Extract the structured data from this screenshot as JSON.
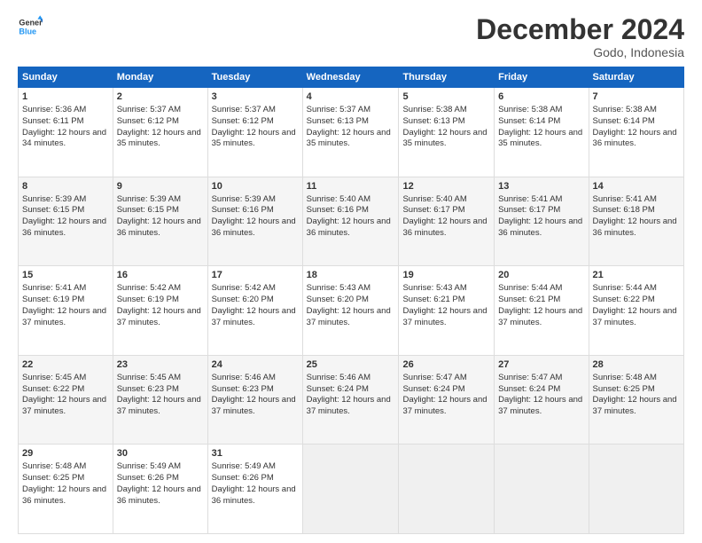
{
  "header": {
    "logo_line1": "General",
    "logo_line2": "Blue",
    "title": "December 2024",
    "subtitle": "Godo, Indonesia"
  },
  "days_of_week": [
    "Sunday",
    "Monday",
    "Tuesday",
    "Wednesday",
    "Thursday",
    "Friday",
    "Saturday"
  ],
  "weeks": [
    [
      {
        "day": 1,
        "rise": "5:36 AM",
        "set": "6:11 PM",
        "light": "12 hours and 34 minutes."
      },
      {
        "day": 2,
        "rise": "5:37 AM",
        "set": "6:12 PM",
        "light": "12 hours and 35 minutes."
      },
      {
        "day": 3,
        "rise": "5:37 AM",
        "set": "6:12 PM",
        "light": "12 hours and 35 minutes."
      },
      {
        "day": 4,
        "rise": "5:37 AM",
        "set": "6:13 PM",
        "light": "12 hours and 35 minutes."
      },
      {
        "day": 5,
        "rise": "5:38 AM",
        "set": "6:13 PM",
        "light": "12 hours and 35 minutes."
      },
      {
        "day": 6,
        "rise": "5:38 AM",
        "set": "6:14 PM",
        "light": "12 hours and 35 minutes."
      },
      {
        "day": 7,
        "rise": "5:38 AM",
        "set": "6:14 PM",
        "light": "12 hours and 36 minutes."
      }
    ],
    [
      {
        "day": 8,
        "rise": "5:39 AM",
        "set": "6:15 PM",
        "light": "12 hours and 36 minutes."
      },
      {
        "day": 9,
        "rise": "5:39 AM",
        "set": "6:15 PM",
        "light": "12 hours and 36 minutes."
      },
      {
        "day": 10,
        "rise": "5:39 AM",
        "set": "6:16 PM",
        "light": "12 hours and 36 minutes."
      },
      {
        "day": 11,
        "rise": "5:40 AM",
        "set": "6:16 PM",
        "light": "12 hours and 36 minutes."
      },
      {
        "day": 12,
        "rise": "5:40 AM",
        "set": "6:17 PM",
        "light": "12 hours and 36 minutes."
      },
      {
        "day": 13,
        "rise": "5:41 AM",
        "set": "6:17 PM",
        "light": "12 hours and 36 minutes."
      },
      {
        "day": 14,
        "rise": "5:41 AM",
        "set": "6:18 PM",
        "light": "12 hours and 36 minutes."
      }
    ],
    [
      {
        "day": 15,
        "rise": "5:41 AM",
        "set": "6:19 PM",
        "light": "12 hours and 37 minutes."
      },
      {
        "day": 16,
        "rise": "5:42 AM",
        "set": "6:19 PM",
        "light": "12 hours and 37 minutes."
      },
      {
        "day": 17,
        "rise": "5:42 AM",
        "set": "6:20 PM",
        "light": "12 hours and 37 minutes."
      },
      {
        "day": 18,
        "rise": "5:43 AM",
        "set": "6:20 PM",
        "light": "12 hours and 37 minutes."
      },
      {
        "day": 19,
        "rise": "5:43 AM",
        "set": "6:21 PM",
        "light": "12 hours and 37 minutes."
      },
      {
        "day": 20,
        "rise": "5:44 AM",
        "set": "6:21 PM",
        "light": "12 hours and 37 minutes."
      },
      {
        "day": 21,
        "rise": "5:44 AM",
        "set": "6:22 PM",
        "light": "12 hours and 37 minutes."
      }
    ],
    [
      {
        "day": 22,
        "rise": "5:45 AM",
        "set": "6:22 PM",
        "light": "12 hours and 37 minutes."
      },
      {
        "day": 23,
        "rise": "5:45 AM",
        "set": "6:23 PM",
        "light": "12 hours and 37 minutes."
      },
      {
        "day": 24,
        "rise": "5:46 AM",
        "set": "6:23 PM",
        "light": "12 hours and 37 minutes."
      },
      {
        "day": 25,
        "rise": "5:46 AM",
        "set": "6:24 PM",
        "light": "12 hours and 37 minutes."
      },
      {
        "day": 26,
        "rise": "5:47 AM",
        "set": "6:24 PM",
        "light": "12 hours and 37 minutes."
      },
      {
        "day": 27,
        "rise": "5:47 AM",
        "set": "6:24 PM",
        "light": "12 hours and 37 minutes."
      },
      {
        "day": 28,
        "rise": "5:48 AM",
        "set": "6:25 PM",
        "light": "12 hours and 37 minutes."
      }
    ],
    [
      {
        "day": 29,
        "rise": "5:48 AM",
        "set": "6:25 PM",
        "light": "12 hours and 36 minutes."
      },
      {
        "day": 30,
        "rise": "5:49 AM",
        "set": "6:26 PM",
        "light": "12 hours and 36 minutes."
      },
      {
        "day": 31,
        "rise": "5:49 AM",
        "set": "6:26 PM",
        "light": "12 hours and 36 minutes."
      },
      null,
      null,
      null,
      null
    ]
  ]
}
